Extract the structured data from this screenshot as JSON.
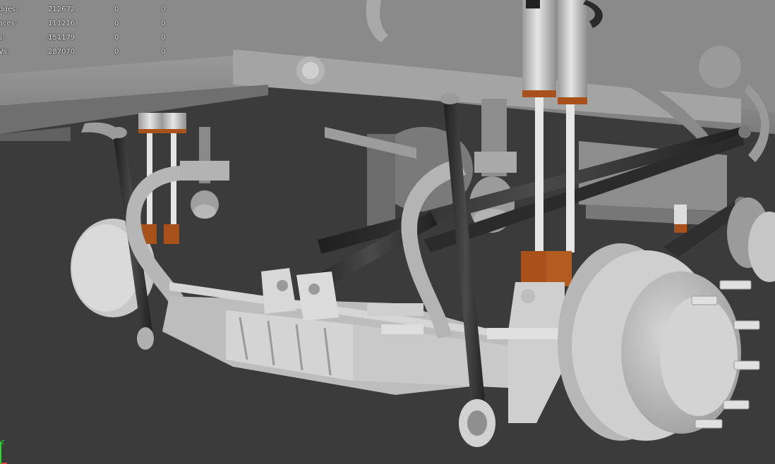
{
  "viewport": {
    "hud_stats": [
      {
        "label": "dges:",
        "c1": "212672",
        "c2": "0",
        "c3": "0"
      },
      {
        "label": "aces:",
        "c1": "111216",
        "c2": "0",
        "c3": "0"
      },
      {
        "label": "s:",
        "c1": "151179",
        "c2": "0",
        "c3": "0"
      },
      {
        "label": "Vs:",
        "c1": "287070",
        "c2": "0",
        "c3": "0"
      }
    ],
    "axis_gizmo_label": "Z",
    "colors": {
      "background": "#3b3b3b",
      "model_gray": "#a9a9a9",
      "rod_dark": "#2c2c2c",
      "rubber_orange": "#a8511a",
      "engine_red": "#e33a12",
      "engine_blue": "#4a4a8a"
    }
  }
}
